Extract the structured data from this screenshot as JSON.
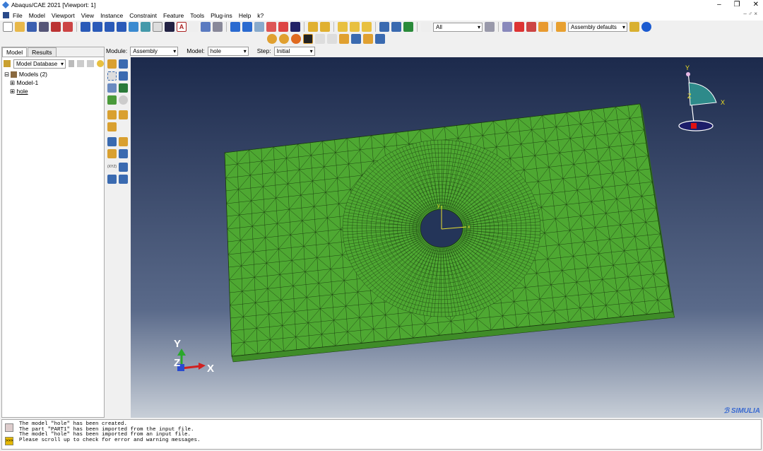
{
  "window": {
    "title": "Abaqus/CAE 2021 [Viewport: 1]",
    "controls": [
      "–",
      "❐",
      "✕"
    ]
  },
  "menu": {
    "items": [
      "File",
      "Model",
      "Viewport",
      "View",
      "Instance",
      "Constraint",
      "Feature",
      "Tools",
      "Plug-ins",
      "Help",
      "k?"
    ],
    "right_mini": "– ♂ ×"
  },
  "toolbar": {
    "selection_filter": "All",
    "render_style": "Assembly defaults"
  },
  "context": {
    "module_label": "Module:",
    "module_value": "Assembly",
    "model_label": "Model:",
    "model_value": "hole",
    "step_label": "Step:",
    "step_value": "Initial"
  },
  "left_panel": {
    "tabs": [
      "Model",
      "Results"
    ],
    "db_label": "Model Database",
    "tree": [
      "Models (2)",
      "Model-1",
      "hole"
    ]
  },
  "viewport": {
    "triad": {
      "y": "Y",
      "z": "Z",
      "x": "X"
    },
    "view_triad": {
      "y": "Y",
      "z": "Z",
      "x": "X"
    },
    "local_axis": {
      "y": "y",
      "x": "x"
    },
    "brand": "SIMULIA",
    "colors": {
      "mesh_fill": "#4ea832",
      "mesh_line": "#1b3a10",
      "bg_top": "#1c2a4c",
      "bg_bottom": "#c8cfd8"
    }
  },
  "messages": [
    "The model \"hole\" has been created.",
    "The part \"PART1\" has been imported from the input file.",
    "The model \"hole\" has been imported from an input file.",
    "Please scroll up to check for error and warning messages."
  ]
}
